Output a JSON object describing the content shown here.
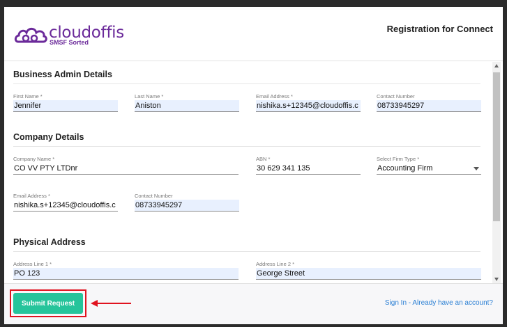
{
  "header": {
    "logo_text": "cloudoffis",
    "logo_tagline": "SMSF Sorted",
    "title": "Registration for Connect"
  },
  "sections": {
    "business_admin": {
      "title": "Business Admin Details",
      "first_name": {
        "label": "First Name *",
        "value": "Jennifer"
      },
      "last_name": {
        "label": "Last Name *",
        "value": "Aniston"
      },
      "email": {
        "label": "Email Address *",
        "value": "nishika.s+12345@cloudoffis.c"
      },
      "contact": {
        "label": "Contact Number",
        "value": "08733945297"
      }
    },
    "company": {
      "title": "Company Details",
      "company_name": {
        "label": "Company Name *",
        "value": "CO VV PTY LTDnr"
      },
      "abn": {
        "label": "ABN *",
        "value": "30 629 341 135"
      },
      "firm_type": {
        "label": "Select Firm Type *",
        "value": "Accounting Firm"
      },
      "email": {
        "label": "Email Address *",
        "value": "nishika.s+12345@cloudoffis.c"
      },
      "contact": {
        "label": "Contact Number",
        "value": "08733945297"
      }
    },
    "physical_address": {
      "title": "Physical Address",
      "line1": {
        "label": "Address Line 1 *",
        "value": "PO 123"
      },
      "line2": {
        "label": "Address Line 2 *",
        "value": "George Street"
      }
    }
  },
  "footer": {
    "submit_label": "Submit Request",
    "signin_label": "Sign In - Already have an account?"
  },
  "colors": {
    "brand": "#6b2a9a",
    "submit": "#26c49b",
    "highlight": "#e0131f",
    "link": "#2a7fd4"
  }
}
